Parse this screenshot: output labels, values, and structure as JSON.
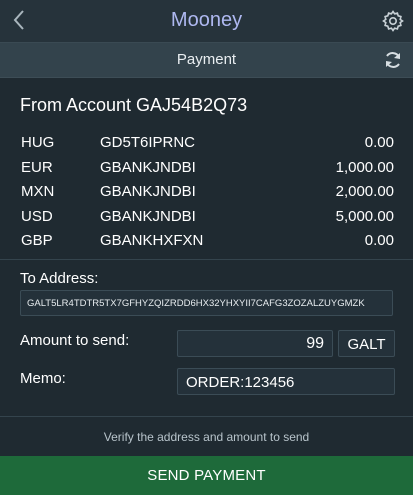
{
  "header": {
    "back_icon": "chevron-left-icon",
    "title": "Mooney",
    "settings_icon": "gear-icon"
  },
  "subheader": {
    "title": "Payment",
    "refresh_icon": "refresh-icon"
  },
  "account": {
    "title": "From Account GAJ54B2Q73",
    "assets": [
      {
        "code": "HUG",
        "issuer": "GD5T6IPRNC",
        "balance": "0.00"
      },
      {
        "code": "EUR",
        "issuer": "GBANKJNDBI",
        "balance": "1,000.00"
      },
      {
        "code": "MXN",
        "issuer": "GBANKJNDBI",
        "balance": "2,000.00"
      },
      {
        "code": "USD",
        "issuer": "GBANKJNDBI",
        "balance": "5,000.00"
      },
      {
        "code": "GBP",
        "issuer": "GBANKHXFXN",
        "balance": "0.00"
      }
    ]
  },
  "form": {
    "to_label": "To Address:",
    "to_value": "GALT5LR4TDTR5TX7GFHYZQIZRDD6HX32YHXYII7CAFG3ZOZALZUYGMZK",
    "amount_label": "Amount to send:",
    "amount_value": "99",
    "asset_code": "GALT",
    "memo_label": "Memo:",
    "memo_value": "ORDER:123456"
  },
  "footer": {
    "hint": "Verify the address and amount to send",
    "send_label": "SEND PAYMENT"
  },
  "colors": {
    "header_bg": "#26333b",
    "subheader_bg": "#33434c",
    "body_bg": "#1f2a31",
    "title_accent": "#aeb8f0",
    "send_button": "#1e6a3a"
  }
}
